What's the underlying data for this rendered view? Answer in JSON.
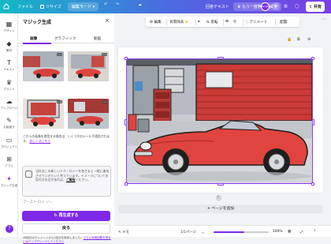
{
  "topbar": {
    "file": "ファイル",
    "resize": "リサイズ",
    "edit_mode": "編集モード",
    "doc_title": "回答テキスト",
    "try_free": "もう一度無料で試す",
    "avatar": "Kanghee",
    "share": "共有"
  },
  "rail": {
    "items": [
      {
        "label": "デザイン",
        "icon": "layout-icon"
      },
      {
        "label": "素材",
        "icon": "elements-icon"
      },
      {
        "label": "テキスト",
        "icon": "text-icon"
      },
      {
        "label": "ブランド",
        "icon": "brand-icon"
      },
      {
        "label": "アップロード",
        "icon": "upload-icon"
      },
      {
        "label": "お絵描き",
        "icon": "draw-icon"
      },
      {
        "label": "プロジェクト",
        "icon": "folder-icon"
      },
      {
        "label": "アプリ",
        "icon": "apps-icon"
      },
      {
        "label": "マジック生成",
        "icon": "magic-icon"
      }
    ]
  },
  "panel": {
    "title": "マジック生成",
    "tabs": [
      "画像",
      "グラフィック",
      "動画"
    ],
    "active_tab": "画像",
    "note": "これらの画像を使用する場合は、いくつかのルールが適用されます。",
    "note_link": "詳しくはこちら",
    "prompt_text": "当社はこの新しいテクノロジーを皆さまと一緒に進化させていきたいと考えています。イメージについてお気付きの点があれば、",
    "prompt_link": "ご報告",
    "prompt_tail": "ください。",
    "cut_text": "ブースト ロン ソー",
    "regenerate": "再生成する",
    "back": "戻る",
    "credit": "46回分のクレジットから1回分を使用しました。",
    "credit_link": "さらに利用回数を得るにはアップグレードしてください"
  },
  "toolbar": {
    "edit": "編集",
    "bg_remove": "背景除去",
    "flip": "反転",
    "animate": "アニメート",
    "position": "配置"
  },
  "bottom": {
    "notes": "メモ",
    "page": "1/1ページ",
    "zoom": "189%",
    "zoom_fraction": 0.55
  },
  "canvas": {
    "add_page": "+ ページを追加"
  },
  "colors": {
    "accent": "#7d2ae8",
    "car": "#e0443f",
    "wall": "#cc3b37"
  }
}
